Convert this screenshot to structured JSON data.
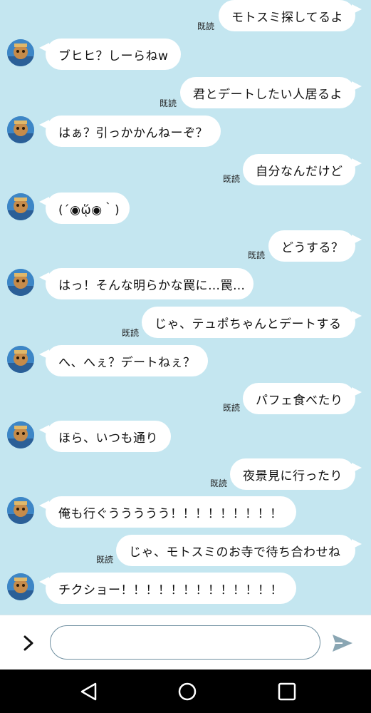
{
  "read_label": "既読",
  "messages": [
    {
      "side": "right",
      "text": "モトスミ探してるよ"
    },
    {
      "side": "left",
      "text": "ブヒヒ？しーらねw"
    },
    {
      "side": "right",
      "text": "君とデートしたい人居るよ"
    },
    {
      "side": "left",
      "text": "はぁ？引っかかんねーぞ？"
    },
    {
      "side": "right",
      "text": "自分なんだけど"
    },
    {
      "side": "left",
      "text": "(´◉ᾥ◉｀)"
    },
    {
      "side": "right",
      "text": "どうする？"
    },
    {
      "side": "left",
      "text": "はっ！そんな明らかな罠に…罠…"
    },
    {
      "side": "right",
      "text": "じゃ、テュポちゃんとデートする"
    },
    {
      "side": "left",
      "text": "へ、へぇ？デートねぇ？"
    },
    {
      "side": "right",
      "text": "パフェ食べたり"
    },
    {
      "side": "left",
      "text": "ほら、いつも通り"
    },
    {
      "side": "right",
      "text": "夜景見に行ったり"
    },
    {
      "side": "left",
      "text": "俺も行ぐううううう！！！！！！！！！"
    },
    {
      "side": "right",
      "text": "じゃ、モトスミのお寺で待ち合わせね"
    },
    {
      "side": "left",
      "text": "チクショー！！！！！！！！！！！！！"
    }
  ],
  "input": {
    "value": "",
    "placeholder": ""
  },
  "icons": {
    "expand": "chevron-right-icon",
    "send": "send-icon",
    "back": "back-triangle-icon",
    "home": "home-circle-icon",
    "recents": "recents-square-icon"
  },
  "colors": {
    "chat_background": "#c4e6f0",
    "bubble": "#ffffff",
    "send_icon": "#8aa6b3",
    "nav_bar": "#000000"
  }
}
